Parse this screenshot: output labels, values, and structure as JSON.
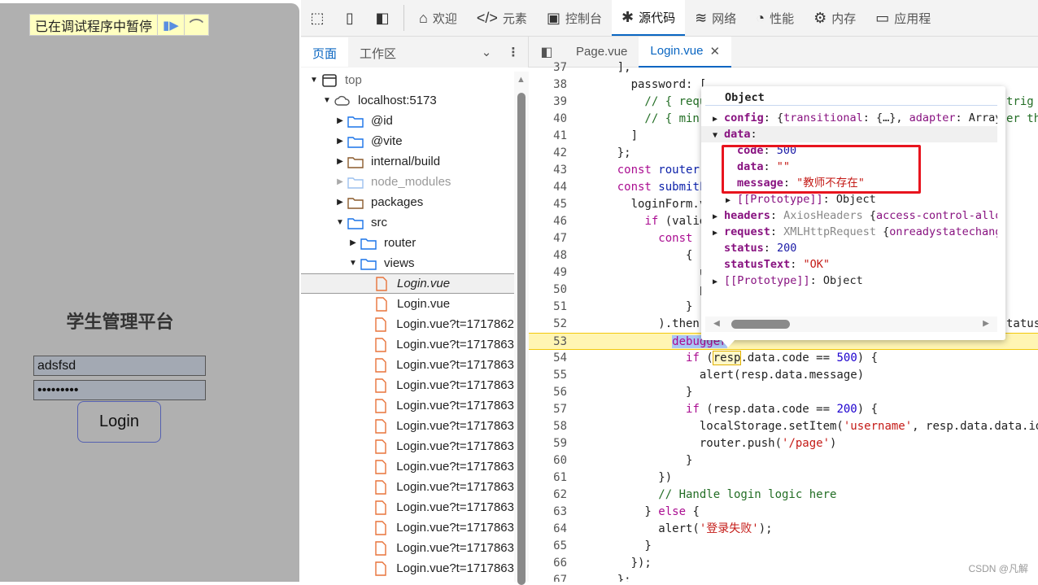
{
  "page": {
    "paused_label": "已在调试程序中暂停",
    "resume_icon": "resume-icon",
    "step_over_icon": "step-over-icon",
    "title": "学生管理平台",
    "username_value": "adsfsd",
    "password_value": "•••••••••",
    "login_label": "Login"
  },
  "toolbar": {
    "tools": [
      "inspect-icon",
      "device-icon",
      "dock-icon"
    ],
    "tabs": [
      {
        "icon": "⌂",
        "label": "欢迎"
      },
      {
        "icon": "</>",
        "label": "元素"
      },
      {
        "icon": "▣",
        "label": "控制台"
      },
      {
        "icon": "✱",
        "label": "源代码",
        "active": true
      },
      {
        "icon": "≋",
        "label": "网络"
      },
      {
        "icon": "◔",
        "label": "性能"
      },
      {
        "icon": "⚙",
        "label": "内存"
      },
      {
        "icon": "▭",
        "label": "应用程"
      }
    ]
  },
  "navigator": {
    "tabs": [
      "页面",
      "工作区"
    ]
  },
  "tree": [
    {
      "label": "top",
      "depth": 0,
      "type": "frame",
      "open": true
    },
    {
      "label": "localhost:5173",
      "depth": 1,
      "type": "cloud",
      "open": true
    },
    {
      "label": "@id",
      "depth": 2,
      "type": "folder",
      "open": false
    },
    {
      "label": "@vite",
      "depth": 2,
      "type": "folder",
      "open": false
    },
    {
      "label": "internal/build",
      "depth": 2,
      "type": "folder-brown",
      "open": false
    },
    {
      "label": "node_modules",
      "depth": 2,
      "type": "folder",
      "open": false,
      "dim": true
    },
    {
      "label": "packages",
      "depth": 2,
      "type": "folder-brown",
      "open": false
    },
    {
      "label": "src",
      "depth": 2,
      "type": "folder",
      "open": true
    },
    {
      "label": "router",
      "depth": 3,
      "type": "folder",
      "open": false
    },
    {
      "label": "views",
      "depth": 3,
      "type": "folder",
      "open": true
    },
    {
      "label": "Login.vue",
      "depth": 4,
      "type": "file",
      "selected": true,
      "italic": true
    },
    {
      "label": "Login.vue",
      "depth": 4,
      "type": "file"
    },
    {
      "label": "Login.vue?t=1717862",
      "depth": 4,
      "type": "file"
    },
    {
      "label": "Login.vue?t=1717863",
      "depth": 4,
      "type": "file"
    },
    {
      "label": "Login.vue?t=1717863",
      "depth": 4,
      "type": "file"
    },
    {
      "label": "Login.vue?t=1717863",
      "depth": 4,
      "type": "file"
    },
    {
      "label": "Login.vue?t=1717863",
      "depth": 4,
      "type": "file"
    },
    {
      "label": "Login.vue?t=1717863",
      "depth": 4,
      "type": "file"
    },
    {
      "label": "Login.vue?t=1717863",
      "depth": 4,
      "type": "file"
    },
    {
      "label": "Login.vue?t=1717863",
      "depth": 4,
      "type": "file"
    },
    {
      "label": "Login.vue?t=1717863",
      "depth": 4,
      "type": "file"
    },
    {
      "label": "Login.vue?t=1717863",
      "depth": 4,
      "type": "file"
    },
    {
      "label": "Login.vue?t=1717863",
      "depth": 4,
      "type": "file"
    },
    {
      "label": "Login.vue?t=1717863",
      "depth": 4,
      "type": "file"
    },
    {
      "label": "Login.vue?t=1717863",
      "depth": 4,
      "type": "file"
    }
  ],
  "file_tabs": [
    {
      "label": "Page.vue"
    },
    {
      "label": "Login.vue",
      "active": true
    }
  ],
  "code": [
    {
      "n": "37",
      "t": [
        [
          "    ],",
          "pl"
        ]
      ]
    },
    {
      "n": "38",
      "t": [
        [
          "      password: [",
          "pl"
        ]
      ]
    },
    {
      "n": "39",
      "t": [
        [
          "        // { requ",
          "cm"
        ]
      ],
      "r": [
        [
          "trig",
          "cm"
        ]
      ]
    },
    {
      "n": "40",
      "t": [
        [
          "        // { min:",
          "cm"
        ]
      ],
      "r": [
        [
          "er th",
          "cm"
        ]
      ]
    },
    {
      "n": "41",
      "t": [
        [
          "      ]",
          "pl"
        ]
      ]
    },
    {
      "n": "42",
      "t": [
        [
          "    };",
          "pl"
        ]
      ]
    },
    {
      "n": "43",
      "t": [
        [
          "    ",
          "pl"
        ],
        [
          "const",
          "kw"
        ],
        [
          " router",
          "id"
        ]
      ]
    },
    {
      "n": "44",
      "t": [
        [
          "    ",
          "pl"
        ],
        [
          "const",
          "kw"
        ],
        [
          " submitF",
          "id"
        ]
      ]
    },
    {
      "n": "45",
      "t": [
        [
          "      loginForm.v",
          "pl"
        ]
      ]
    },
    {
      "n": "46",
      "t": [
        [
          "        ",
          "pl"
        ],
        [
          "if",
          "kw"
        ],
        [
          " (valid",
          "pl"
        ]
      ]
    },
    {
      "n": "47",
      "t": [
        [
          "          ",
          "pl"
        ],
        [
          "const",
          "kw"
        ],
        [
          " r",
          "pl"
        ]
      ]
    },
    {
      "n": "48",
      "t": [
        [
          "              {",
          "pl"
        ]
      ]
    },
    {
      "n": "49",
      "t": [
        [
          "                u",
          "pl"
        ]
      ]
    },
    {
      "n": "50",
      "t": [
        [
          "                p",
          "pl"
        ]
      ]
    },
    {
      "n": "51",
      "t": [
        [
          "              }",
          "pl"
        ]
      ]
    },
    {
      "n": "52",
      "t": [
        [
          "          ).then(",
          "pl"
        ]
      ],
      "r": [
        [
          "tatusT",
          "pl"
        ]
      ]
    },
    {
      "n": "53",
      "paused": true,
      "t": [
        [
          "            ",
          "pl"
        ],
        [
          "debugger",
          "kw dbg"
        ]
      ]
    },
    {
      "n": "54",
      "t": [
        [
          "              ",
          "pl"
        ],
        [
          "if",
          "kw"
        ],
        [
          " (",
          "pl"
        ],
        [
          "resp",
          "pl hl"
        ],
        [
          ".data.code == ",
          "pl"
        ],
        [
          "500",
          "num"
        ],
        [
          ") {",
          "pl"
        ]
      ]
    },
    {
      "n": "55",
      "t": [
        [
          "                alert(resp.data.message)",
          "pl"
        ]
      ]
    },
    {
      "n": "56",
      "t": [
        [
          "              }",
          "pl"
        ]
      ]
    },
    {
      "n": "57",
      "t": [
        [
          "              ",
          "pl"
        ],
        [
          "if",
          "kw"
        ],
        [
          " (resp.data.code == ",
          "pl"
        ],
        [
          "200",
          "num"
        ],
        [
          ") {",
          "pl"
        ]
      ]
    },
    {
      "n": "58",
      "t": [
        [
          "                localStorage.setItem(",
          "pl"
        ],
        [
          "'username'",
          "str"
        ],
        [
          ", resp.data.data.id)",
          "pl"
        ]
      ]
    },
    {
      "n": "59",
      "t": [
        [
          "                router.push(",
          "pl"
        ],
        [
          "'/page'",
          "str"
        ],
        [
          ")",
          "pl"
        ]
      ]
    },
    {
      "n": "60",
      "t": [
        [
          "              }",
          "pl"
        ]
      ]
    },
    {
      "n": "61",
      "t": [
        [
          "          })",
          "pl"
        ]
      ]
    },
    {
      "n": "62",
      "t": [
        [
          "          // Handle login logic here",
          "cm"
        ]
      ]
    },
    {
      "n": "63",
      "t": [
        [
          "        } ",
          "pl"
        ],
        [
          "else",
          "kw"
        ],
        [
          " {",
          "pl"
        ]
      ]
    },
    {
      "n": "64",
      "t": [
        [
          "          alert(",
          "pl"
        ],
        [
          "'登录失败'",
          "str"
        ],
        [
          ");",
          "pl"
        ]
      ]
    },
    {
      "n": "65",
      "t": [
        [
          "        }",
          "pl"
        ]
      ]
    },
    {
      "n": "66",
      "t": [
        [
          "      });",
          "pl"
        ]
      ]
    },
    {
      "n": "67",
      "t": [
        [
          "    };",
          "pl"
        ]
      ]
    }
  ],
  "popup": {
    "title": "Object",
    "rows": [
      {
        "tri": "▶",
        "indent": 0,
        "t": [
          [
            "config",
            "pk"
          ],
          [
            ": {",
            "pl"
          ],
          [
            "transitional",
            "pv"
          ],
          [
            ": {…}, ",
            "pl"
          ],
          [
            "adapter",
            "pv"
          ],
          [
            ": Array",
            "pl"
          ]
        ]
      },
      {
        "tri": "▼",
        "indent": 0,
        "sel": true,
        "t": [
          [
            "data",
            "pk"
          ],
          [
            ":",
            "pl"
          ]
        ]
      },
      {
        "tri": "",
        "indent": 1,
        "t": [
          [
            "code",
            "pk"
          ],
          [
            ": ",
            "pl"
          ],
          [
            "500",
            "pb"
          ]
        ]
      },
      {
        "tri": "",
        "indent": 1,
        "t": [
          [
            "data",
            "pk"
          ],
          [
            ": ",
            "pl"
          ],
          [
            "\"\"",
            "ps"
          ]
        ]
      },
      {
        "tri": "",
        "indent": 1,
        "t": [
          [
            "message",
            "pk"
          ],
          [
            ": ",
            "pl"
          ],
          [
            "\"教师不存在\"",
            "ps"
          ]
        ]
      },
      {
        "tri": "▶",
        "indent": 1,
        "t": [
          [
            "[[Prototype]]",
            "pv"
          ],
          [
            ": Object",
            "pl"
          ]
        ]
      },
      {
        "tri": "▶",
        "indent": 0,
        "t": [
          [
            "headers",
            "pk"
          ],
          [
            ": ",
            "pl"
          ],
          [
            "AxiosHeaders ",
            "pg"
          ],
          [
            "{",
            "pl"
          ],
          [
            "access-control-allow",
            "pv"
          ]
        ]
      },
      {
        "tri": "▶",
        "indent": 0,
        "t": [
          [
            "request",
            "pk"
          ],
          [
            ": ",
            "pl"
          ],
          [
            "XMLHttpRequest ",
            "pg"
          ],
          [
            "{",
            "pl"
          ],
          [
            "onreadystatechange",
            "pv"
          ]
        ]
      },
      {
        "tri": "",
        "indent": 0,
        "t": [
          [
            "status",
            "pk"
          ],
          [
            ": ",
            "pl"
          ],
          [
            "200",
            "pb"
          ]
        ]
      },
      {
        "tri": "",
        "indent": 0,
        "t": [
          [
            "statusText",
            "pk"
          ],
          [
            ": ",
            "pl"
          ],
          [
            "\"OK\"",
            "ps"
          ]
        ]
      },
      {
        "tri": "▶",
        "indent": 0,
        "t": [
          [
            "[[Prototype]]",
            "pv"
          ],
          [
            ": Object",
            "pl"
          ]
        ]
      }
    ],
    "highlight_color": "#e8141e"
  },
  "watermark": "CSDN @凡解"
}
